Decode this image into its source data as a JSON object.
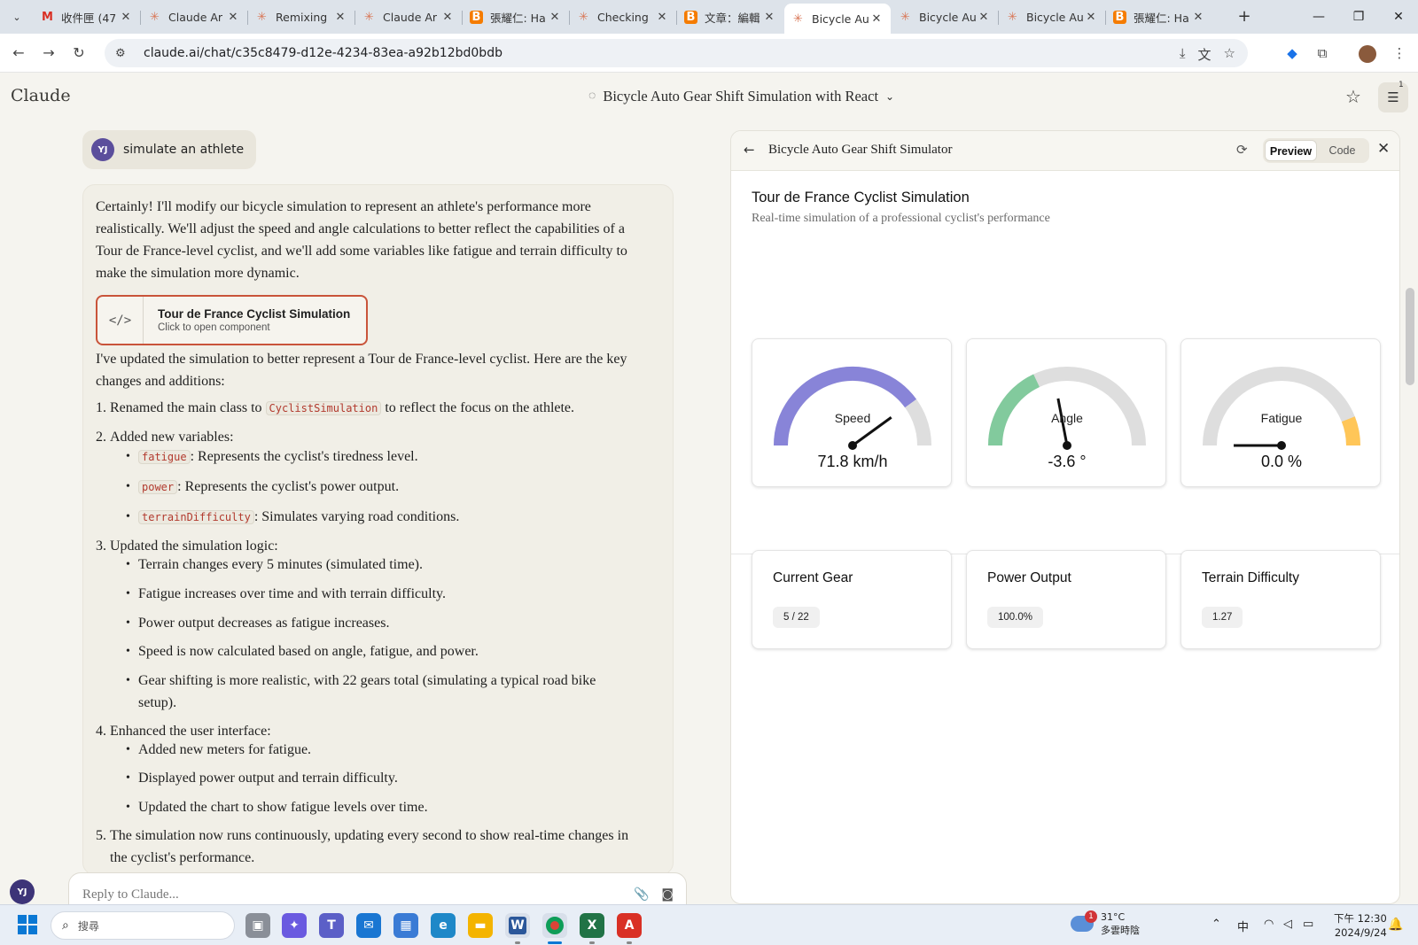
{
  "browser": {
    "tabs": [
      {
        "title": "收件匣 (47",
        "favicon": "gmail-icon",
        "active": false
      },
      {
        "title": "Claude Ar",
        "favicon": "claude-icon",
        "active": false
      },
      {
        "title": "Remixing",
        "favicon": "claude-icon",
        "active": false
      },
      {
        "title": "Claude Ar",
        "favicon": "claude-icon",
        "active": false
      },
      {
        "title": "張耀仁: Ha",
        "favicon": "blogger-icon",
        "active": false
      },
      {
        "title": "Checking",
        "favicon": "claude-icon",
        "active": false
      },
      {
        "title": "文章：編輯",
        "favicon": "blogger-icon",
        "active": false
      },
      {
        "title": "Bicycle Au",
        "favicon": "claude-icon",
        "active": true
      },
      {
        "title": "Bicycle Au",
        "favicon": "claude-icon",
        "active": false
      },
      {
        "title": "Bicycle Au",
        "favicon": "claude-icon",
        "active": false
      },
      {
        "title": "張耀仁: Ha",
        "favicon": "blogger-icon",
        "active": false
      }
    ],
    "url": "claude.ai/chat/c35c8479-d12e-4234-83ea-a92b12bd0bdb"
  },
  "header": {
    "logo": "Claude",
    "chat_title": "Bicycle Auto Gear Shift Simulation with React",
    "settings_badge": "1"
  },
  "chat": {
    "user_initials": "YJ",
    "user_message": "simulate an athlete",
    "intro": "Certainly! I'll modify our bicycle simulation to represent an athlete's performance more realistically. We'll adjust the speed and angle calculations to better reflect the capabilities of a Tour de France-level cyclist, and we'll add some variables like fatigue and terrain difficulty to make the simulation more dynamic.",
    "artifact_title": "Tour de France Cyclist Simulation",
    "artifact_sub": "Click to open component",
    "updated": "I've updated the simulation to better represent a Tour de France-level cyclist. Here are the key changes and additions:",
    "item1_pre": "Renamed the main class to",
    "item1_code": "CyclistSimulation",
    "item1_post": "to reflect the focus on the athlete.",
    "item2": "Added new variables:",
    "var1_code": "fatigue",
    "var1_text": ": Represents the cyclist's tiredness level.",
    "var2_code": "power",
    "var2_text": ": Represents the cyclist's power output.",
    "var3_code": "terrainDifficulty",
    "var3_text": ": Simulates varying road conditions.",
    "item3": "Updated the simulation logic:",
    "logic1": "Terrain changes every 5 minutes (simulated time).",
    "logic2": "Fatigue increases over time and with terrain difficulty.",
    "logic3": "Power output decreases as fatigue increases.",
    "logic4": "Speed is now calculated based on angle, fatigue, and power.",
    "logic5": "Gear shifting is more realistic, with 22 gears total (simulating a typical road bike setup).",
    "item4": "Enhanced the user interface:",
    "ui1": "Added new meters for fatigue.",
    "ui2": "Displayed power output and terrain difficulty.",
    "ui3": "Updated the chart to show fatigue levels over time.",
    "item5": "The simulation now runs continuously, updating every second to show real-time changes in the cyclist's performance.",
    "reply_placeholder": "Reply to Claude..."
  },
  "panel": {
    "title": "Bicycle Auto Gear Shift Simulator",
    "preview_label": "Preview",
    "code_label": "Code",
    "sim_title": "Tour de France Cyclist Simulation",
    "sim_subtitle": "Real-time simulation of a professional cyclist's performance",
    "gauges": [
      {
        "label": "Speed",
        "value": "71.8 km/h",
        "fill_fraction": 0.8,
        "color": "#8884d8",
        "needle_fraction": 0.8
      },
      {
        "label": "Angle",
        "value": "-3.6 °",
        "fill_fraction": 0.36,
        "color": "#82ca9d",
        "needle_fraction": 0.44
      },
      {
        "label": "Fatigue",
        "value": "0.0 %",
        "fill_fraction": 0.12,
        "color": "#ffc658",
        "needle_fraction": 0.0
      }
    ],
    "cards": [
      {
        "title": "Current Gear",
        "value": "5 / 22"
      },
      {
        "title": "Power Output",
        "value": "100.0%"
      },
      {
        "title": "Terrain Difficulty",
        "value": "1.27"
      }
    ]
  },
  "taskbar": {
    "search_placeholder": "搜尋",
    "weather_temp": "31°C",
    "weather_desc": "多雲時陰",
    "weather_badge": "1",
    "ime": "中",
    "time": "下午 12:30",
    "date": "2024/9/24"
  },
  "colors": {
    "artifact_border": "#c9543a",
    "speed": "#8884d8",
    "angle": "#82ca9d",
    "fatigue": "#ffc658",
    "code_text": "#b23a2e"
  }
}
